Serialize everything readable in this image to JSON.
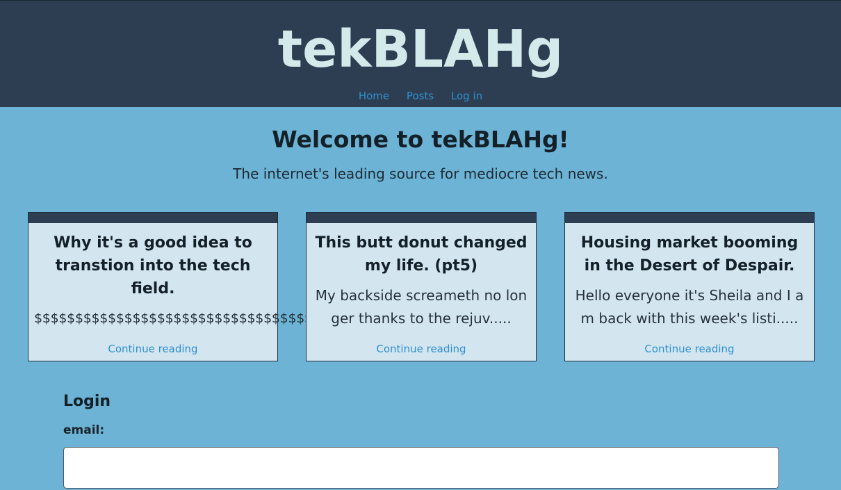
{
  "header": {
    "title": "tekBLAHg",
    "nav": [
      "Home",
      "Posts",
      "Log in"
    ]
  },
  "hero": {
    "heading": "Welcome to tekBLAHg!",
    "tagline": "The internet's leading source for mediocre tech news."
  },
  "posts": [
    {
      "title": "Why it's a good idea to transtion into the tech field.",
      "excerpt": "$$$$$$$$$$$$$$$$$$$$$$$$$$$$$$$$$$$$$$$$$$$$$.....",
      "link": "Continue reading"
    },
    {
      "title": "This butt donut changed my life. (pt5)",
      "excerpt": "My backside screameth no longer thanks to the rejuv.....",
      "link": "Continue reading"
    },
    {
      "title": "Housing market booming in the Desert of Despair.",
      "excerpt": "Hello everyone it's Sheila and I am back with this week's listi.....",
      "link": "Continue reading"
    }
  ],
  "login": {
    "heading": "Login",
    "email_label": "email:",
    "email_value": ""
  },
  "colors": {
    "header_bg": "#2d3e52",
    "page_bg": "#6cb3d5",
    "card_bg": "#d3e6f0",
    "title_text": "#d4eaea",
    "link": "#2f8fcf"
  }
}
